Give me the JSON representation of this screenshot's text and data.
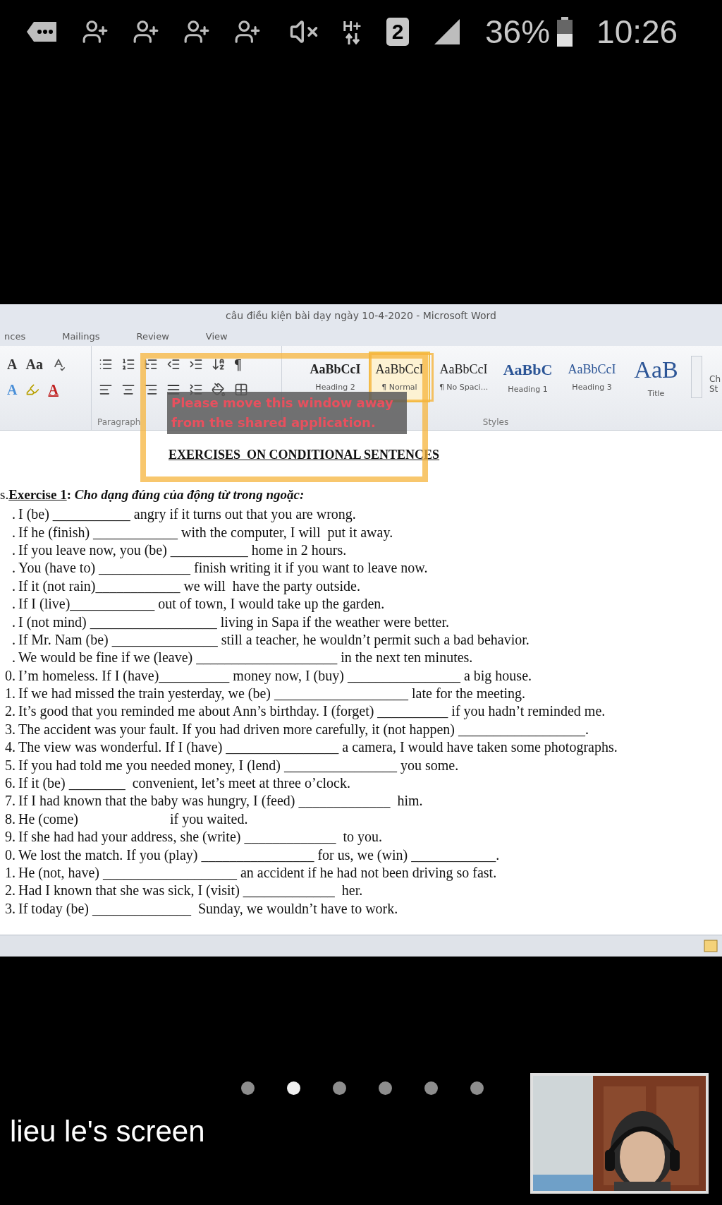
{
  "status_bar": {
    "network": "H+",
    "sim": "2",
    "battery": "36%",
    "time": "10:26"
  },
  "word_window": {
    "title": "câu điều kiện bài dạy ngày 10-4-2020 - Microsoft Word",
    "tabs": [
      "nces",
      "Mailings",
      "Review",
      "View"
    ],
    "font_tools": [
      {
        "glyph": "A",
        "kind": "shrink"
      },
      {
        "glyph": "Aa",
        "kind": "case"
      },
      {
        "glyph": "A",
        "kind": "effects"
      },
      {
        "glyph": "A",
        "kind": "color"
      }
    ],
    "pilcrow": "¶",
    "styles": [
      {
        "preview": "AaBbCcI",
        "label": "Heading 2",
        "kind": "heading2",
        "selected": false
      },
      {
        "preview": "AaBbCcI",
        "label": "¶ Normal",
        "kind": "normal",
        "selected": true
      },
      {
        "preview": "AaBbCcI",
        "label": "¶ No Spaci...",
        "kind": "normal",
        "selected": false
      },
      {
        "preview": "AaBbC",
        "label": "Heading 1",
        "kind": "heading1",
        "selected": false
      },
      {
        "preview": "AaBbCcI",
        "label": "Heading 3",
        "kind": "heading3",
        "selected": false
      },
      {
        "preview": "AaB",
        "label": "Title",
        "kind": "title",
        "selected": false
      }
    ],
    "groups": [
      "Paragraph",
      "Styles"
    ],
    "change_styles": "Ch\nSt",
    "warning": "Please move this window away\nfrom the shared application.",
    "document": {
      "title": "EXERCISES  ON CONDITIONAL SENTENCES",
      "exercise": {
        "prefix": "s.",
        "label": "Exercise 1",
        "separator": ": ",
        "instruction": "Cho dạng đúng của động từ trong ngoặc:"
      },
      "items": [
        {
          "number": ".",
          "text": "I (be) ___________ angry if it turns out that you are wrong."
        },
        {
          "number": ".",
          "text": "If he (finish) ____________ with the computer, I will  put it away."
        },
        {
          "number": ".",
          "text": "If you leave now, you (be) ___________ home in 2 hours."
        },
        {
          "number": ".",
          "text": "You (have to) _____________ finish writing it if you want to leave now."
        },
        {
          "number": ".",
          "text": "If it (not rain)____________ we will  have the party outside."
        },
        {
          "number": ".",
          "text": "If I (live)____________ out of town, I would take up the garden."
        },
        {
          "number": ".",
          "text": "I (not mind) __________________ living in Sapa if the weather were better."
        },
        {
          "number": ".",
          "text": "If Mr. Nam (be) _______________ still a teacher, he wouldn’t permit such a bad behavior."
        },
        {
          "number": ".",
          "text": "We would be fine if we (leave) ____________________ in the next ten minutes."
        },
        {
          "number": "0.",
          "text": "I’m homeless. If I (have)__________ money now, I (buy) ________________ a big house."
        },
        {
          "number": "1.",
          "text": "If we had missed the train yesterday, we (be) ___________________ late for the meeting."
        },
        {
          "number": "2.",
          "text": "It’s good that you reminded me about Ann’s birthday. I (forget) __________ if you hadn’t reminded me."
        },
        {
          "number": "3.",
          "text": "The accident was your fault. If you had driven more carefully, it (not happen) __________________."
        },
        {
          "number": "4.",
          "text": "The view was wonderful. If I (have) ________________ a camera, I would have taken some photographs."
        },
        {
          "number": "5.",
          "text": "If you had told me you needed money, I (lend) ________________ you some."
        },
        {
          "number": "6.",
          "text": "If it (be) ________  convenient, let’s meet at three o’clock."
        },
        {
          "number": "7.",
          "text": "If I had known that the baby was hungry, I (feed) _____________  him."
        },
        {
          "number": "8.",
          "text": "He (come)                          if you waited."
        },
        {
          "number": "9.",
          "text": "If she had had your address, she (write) _____________  to you."
        },
        {
          "number": "0.",
          "text": "We lost the match. If you (play) ________________ for us, we (win) ____________."
        },
        {
          "number": "1.",
          "text": "He (not, have) ___________________ an accident if he had not been driving so fast."
        },
        {
          "number": "2.",
          "text": "Had I known that she was sick, I (visit) _____________  her."
        },
        {
          "number": "3.",
          "text": "If today (be) ______________  Sunday, we wouldn’t have to work."
        }
      ]
    }
  },
  "share": {
    "pages": [
      {
        "selected": false
      },
      {
        "selected": true
      },
      {
        "selected": false
      },
      {
        "selected": false
      },
      {
        "selected": false
      },
      {
        "selected": false
      }
    ],
    "label": "lieu le's screen"
  }
}
